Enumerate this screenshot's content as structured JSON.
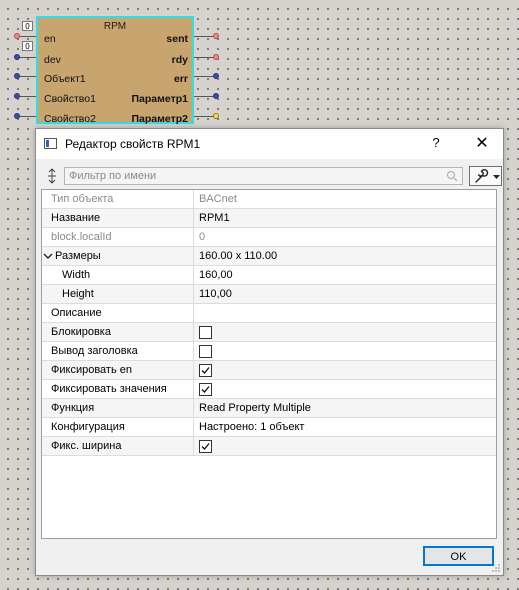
{
  "block": {
    "title": "RPM",
    "inputs": [
      "en",
      "dev",
      "Объект1",
      "Свойство1",
      "Свойство2"
    ],
    "outputs": [
      "sent",
      "rdy",
      "err",
      "Параметр1",
      "Параметр2"
    ],
    "input_values": [
      "0",
      "0"
    ],
    "colors": {
      "body": "#c8a46e",
      "selection": "#2ee0e6"
    }
  },
  "dialog": {
    "title": "Редактор свойств RPM1",
    "help": "?",
    "close": "✕",
    "filter_placeholder": "Фильтр по имени",
    "ok_label": "OK",
    "properties": [
      {
        "name": "Тип объекта",
        "value": "BACnet"
      },
      {
        "name": "Название",
        "value": "RPM1"
      },
      {
        "name": "block.localId",
        "value": "0"
      },
      {
        "name": "Размеры",
        "value": "160.00 x 110.00"
      },
      {
        "name": "Width",
        "value": "160,00"
      },
      {
        "name": "Height",
        "value": "110,00"
      },
      {
        "name": "Описание",
        "value": ""
      },
      {
        "name": "Блокировка",
        "checked": false
      },
      {
        "name": "Вывод заголовка",
        "checked": false
      },
      {
        "name": "Фиксировать en",
        "checked": true
      },
      {
        "name": "Фиксировать значения",
        "checked": true
      },
      {
        "name": "Функция",
        "value": "Read Property Multiple"
      },
      {
        "name": "Конфигурация",
        "value": "Настроено: 1 объект"
      },
      {
        "name": "Фикс. ширина",
        "checked": true
      }
    ]
  }
}
